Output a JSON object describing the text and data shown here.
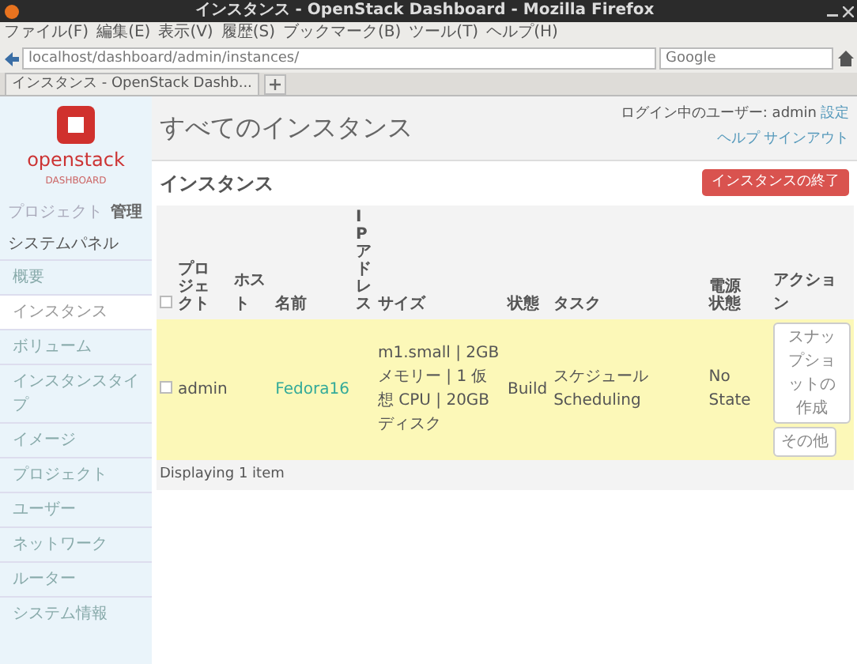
{
  "window": {
    "title": "インスタンス - OpenStack Dashboard - Mozilla Firefox"
  },
  "menu": [
    "ファイル(F)",
    "編集(E)",
    "表示(V)",
    "履歴(S)",
    "ブックマーク(B)",
    "ツール(T)",
    "ヘルプ(H)"
  ],
  "address_bar": {
    "value": "localhost/dashboard/admin/instances/"
  },
  "search": {
    "placeholder": "Google"
  },
  "tabs": [
    {
      "label": "インスタンス - OpenStack Dashb...",
      "selected": true
    }
  ],
  "sidebar": {
    "logo": "openstack",
    "subtitle": "DASHBOARD",
    "switch": [
      {
        "label": "プロジェクト",
        "selected": false
      },
      {
        "label": "管理",
        "selected": true
      }
    ],
    "panel": "システムパネル",
    "items": [
      {
        "label": "概要",
        "selected": false
      },
      {
        "label": "インスタンス",
        "selected": true
      },
      {
        "label": "ボリューム",
        "selected": false
      },
      {
        "label": "インスタンスタイプ",
        "selected": false
      },
      {
        "label": "イメージ",
        "selected": false
      },
      {
        "label": "プロジェクト",
        "selected": false
      },
      {
        "label": "ユーザー",
        "selected": false
      },
      {
        "label": "ネットワーク",
        "selected": false
      },
      {
        "label": "ルーター",
        "selected": false
      },
      {
        "label": "システム情報",
        "selected": false
      }
    ]
  },
  "header": {
    "title": "すべてのインスタンス",
    "user": "ログイン中のユーザー: admin",
    "links": [
      "設定",
      "ヘルプ",
      "サインアウト"
    ]
  },
  "section": {
    "title": "インスタンス",
    "button": "インスタンスの終了"
  },
  "table": {
    "columns": [
      {
        "label": "プロジェクト",
        "kind": "wrap"
      },
      {
        "label": "ホスト",
        "kind": "plain"
      },
      {
        "label": "名前",
        "kind": "plain"
      },
      {
        "label": "IPアドレス",
        "kind": "vertical"
      },
      {
        "label": "サイズ",
        "kind": "plain"
      },
      {
        "label": "状態",
        "kind": "plain"
      },
      {
        "label": "タスク",
        "kind": "plain"
      },
      {
        "label": "電源状態",
        "kind": "wrap"
      },
      {
        "label": "アクション",
        "kind": "plain"
      }
    ],
    "select_all_checked": false,
    "rows": [
      {
        "checked": false,
        "highlighted": true,
        "project": "admin",
        "name": "Fedora16",
        "size": "m1.small | 2GB メモリー | 1 仮想 CPU | 20GB ディスク",
        "state": "Build",
        "task": "スケジュール Scheduling",
        "power": "No State",
        "actions": [
          "スナップショットの作成",
          "その他"
        ]
      }
    ],
    "footer": "Displaying 1 item"
  }
}
